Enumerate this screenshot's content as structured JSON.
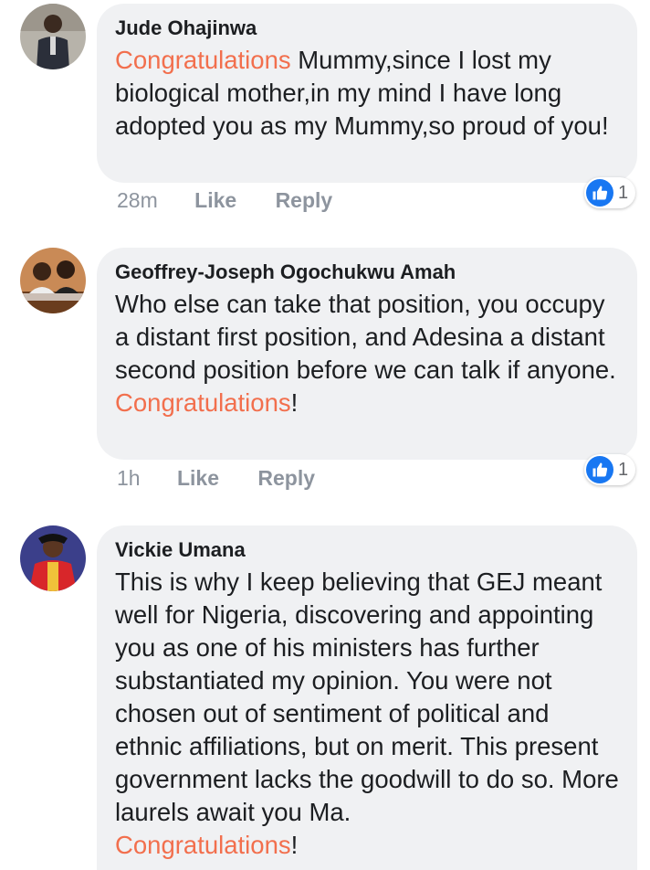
{
  "comments": [
    {
      "author": "Jude Ohajinwa",
      "highlight": "Congratulations",
      "text": " Mummy,since I lost my biological mother,in my mind I have long adopted you as my Mummy,so proud of you!",
      "time": "28m",
      "like_label": "Like",
      "reply_label": "Reply",
      "reaction_count": "1",
      "reaction_icon": "thumbs-up-icon"
    },
    {
      "author": "Geoffrey-Joseph Ogochukwu Amah",
      "text": "Who else can take that position, you occupy a distant first position, and Adesina a distant second position before we can talk if anyone.",
      "highlight": "Congratulations",
      "suffix": "!",
      "time": "1h",
      "like_label": "Like",
      "reply_label": "Reply",
      "reaction_count": "1",
      "reaction_icon": "thumbs-up-icon"
    },
    {
      "author": "Vickie Umana",
      "text": "This is why I keep believing that GEJ meant well for Nigeria, discovering and appointing you as one of his ministers has further substantiated my opinion. You were not chosen out of sentiment of political and ethnic affiliations, but on merit. This present government lacks the goodwill to do so. More laurels await you Ma.",
      "highlight": "Congratulations",
      "suffix": "!"
    }
  ],
  "colors": {
    "bubble_bg": "#f0f1f3",
    "highlight": "#f26f4d",
    "meta_text": "#8d949e",
    "like_blue": "#1877f2"
  }
}
